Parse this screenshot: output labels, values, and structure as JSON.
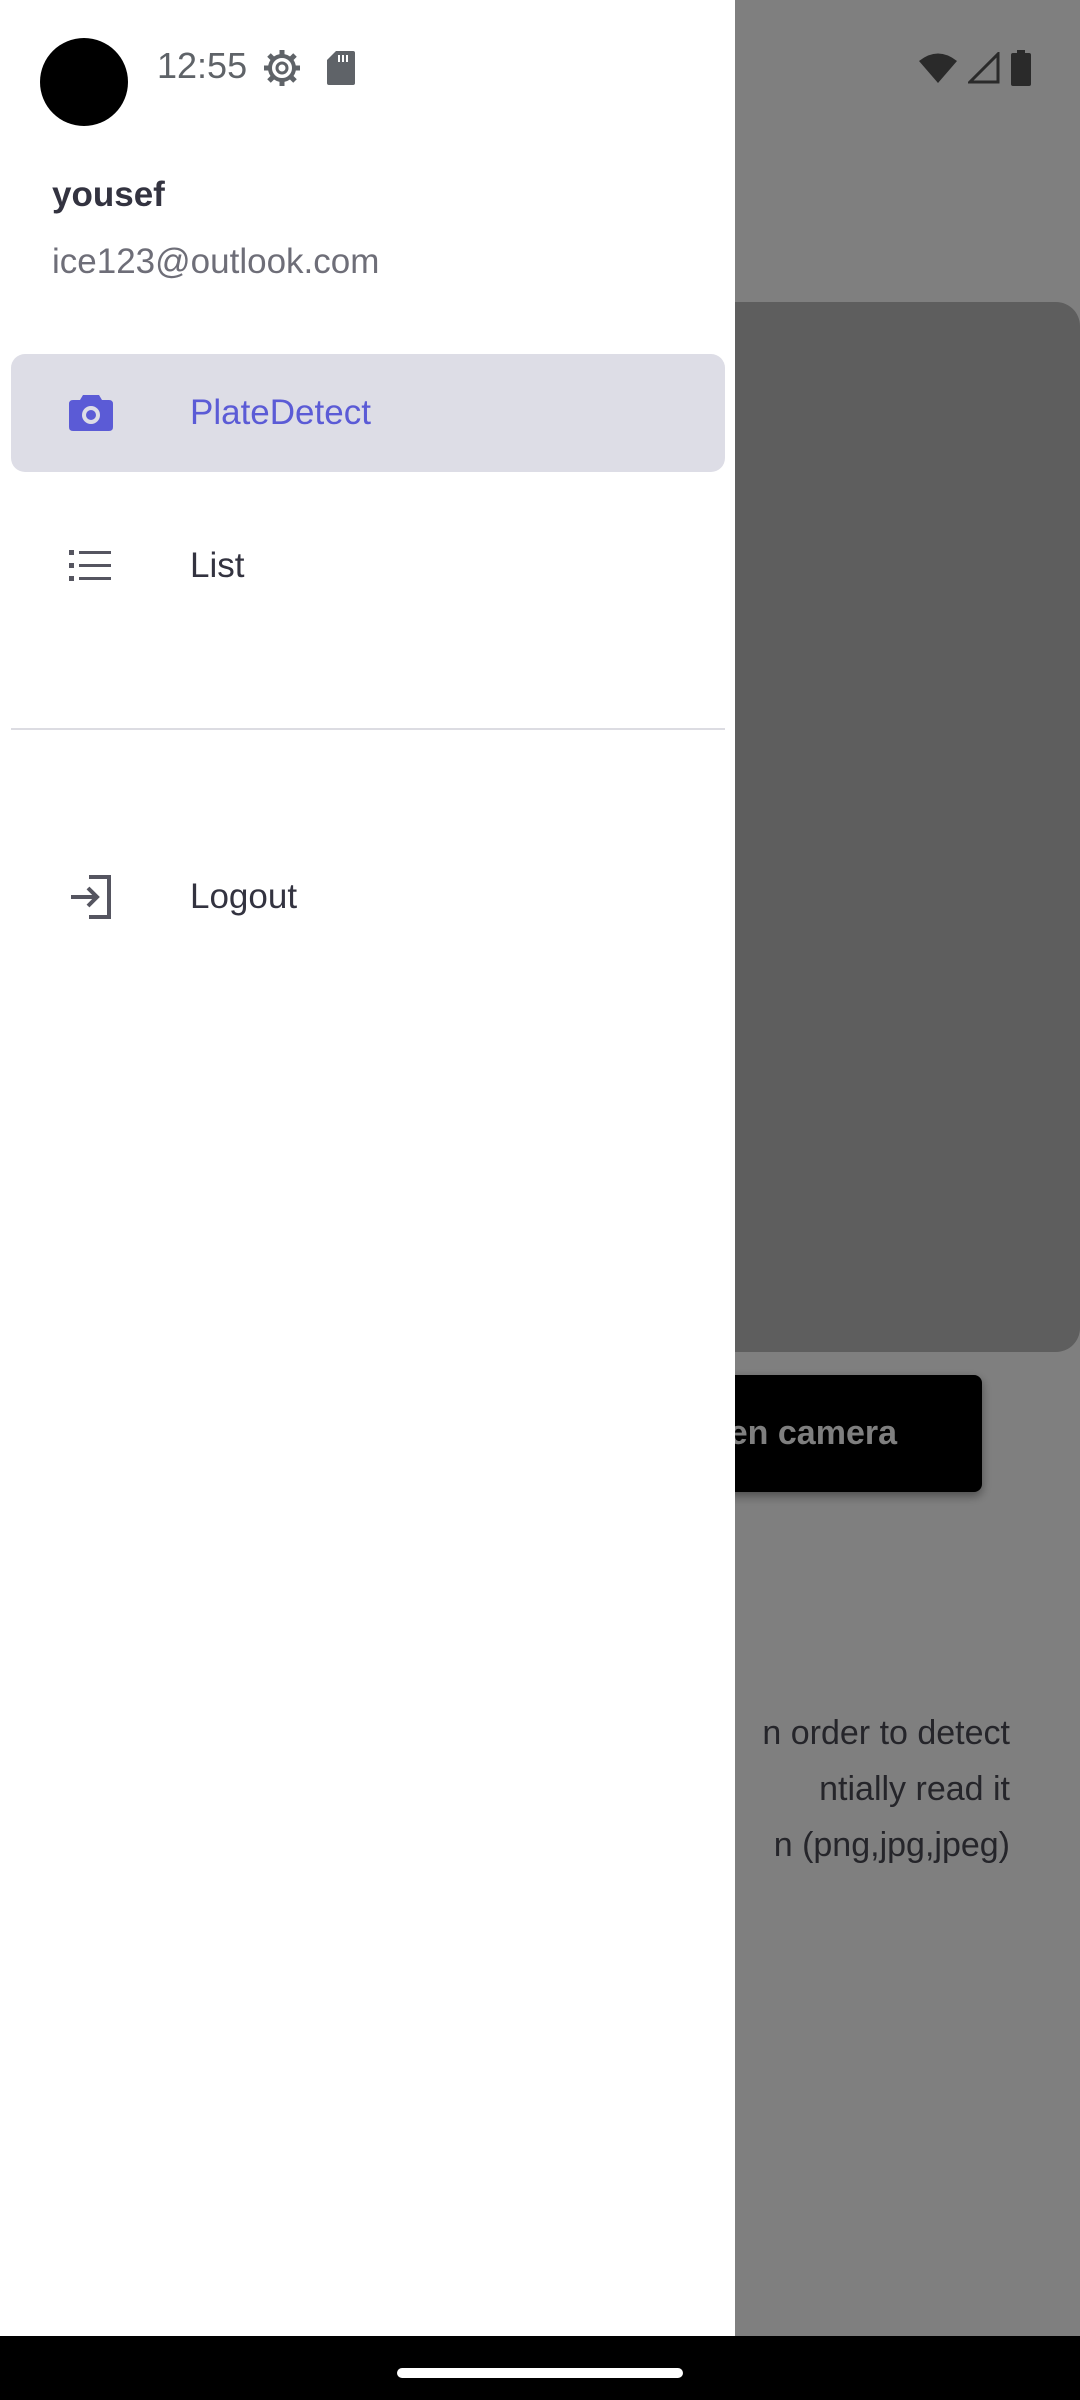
{
  "status_bar": {
    "time": "12:55",
    "icons": [
      "gear-icon",
      "sd-card-icon",
      "wifi-icon",
      "signal-icon",
      "battery-icon"
    ]
  },
  "drawer": {
    "user_name": "yousef",
    "user_email": "ice123@outlook.com",
    "items": [
      {
        "label": "PlateDetect",
        "icon": "camera-icon",
        "active": true
      },
      {
        "label": "List",
        "icon": "list-icon",
        "active": false
      }
    ],
    "logout_label": "Logout",
    "logout_icon": "login-arrow-icon"
  },
  "background_app": {
    "button_label_visible": "en camera",
    "description_lines": [
      "n order to detect",
      "ntially read it",
      "n (png,jpg,jpeg)"
    ]
  },
  "colors": {
    "accent": "#5b5bd6",
    "active_item_bg": "#dddde6",
    "scrim": "rgba(0,0,0,0.5)"
  }
}
